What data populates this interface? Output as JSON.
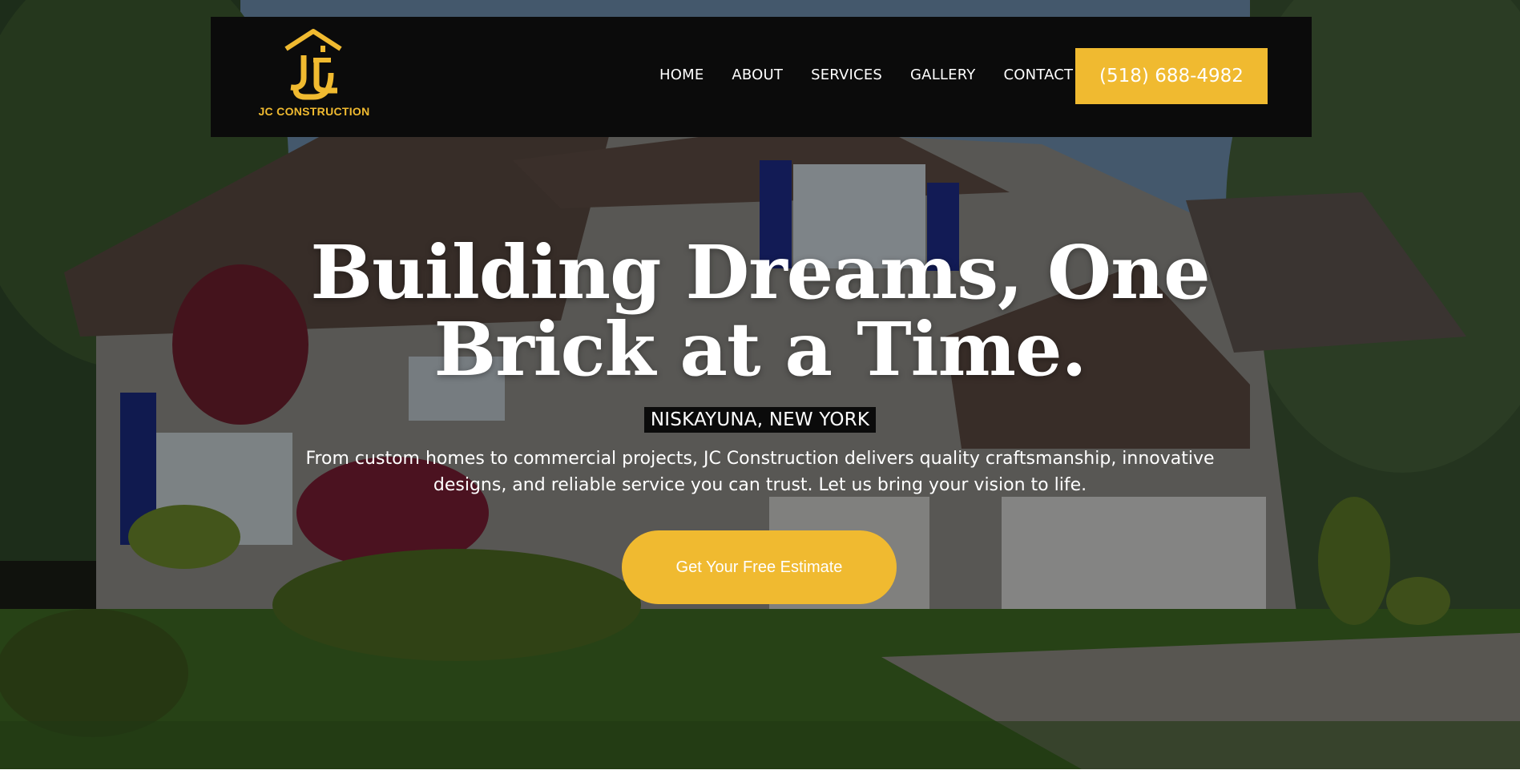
{
  "brand": {
    "name": "JC CONSTRUCTION",
    "logo_icon": "house-jc-logo-icon",
    "accent_color": "#f0ba30"
  },
  "nav": {
    "items": [
      {
        "label": "HOME"
      },
      {
        "label": "ABOUT"
      },
      {
        "label": "SERVICES"
      },
      {
        "label": "GALLERY"
      },
      {
        "label": "CONTACT"
      }
    ],
    "phone": "(518) 688-4982"
  },
  "hero": {
    "title_line1": "Building Dreams, One",
    "title_line2": "Brick at a Time.",
    "location": "NISKAYUNA, NEW YORK",
    "description": "From custom homes to commercial projects, JC Construction delivers quality craftsmanship, innovative designs, and reliable service you can trust. Let us bring your vision to life.",
    "cta_label": "Get Your Free Estimate"
  }
}
